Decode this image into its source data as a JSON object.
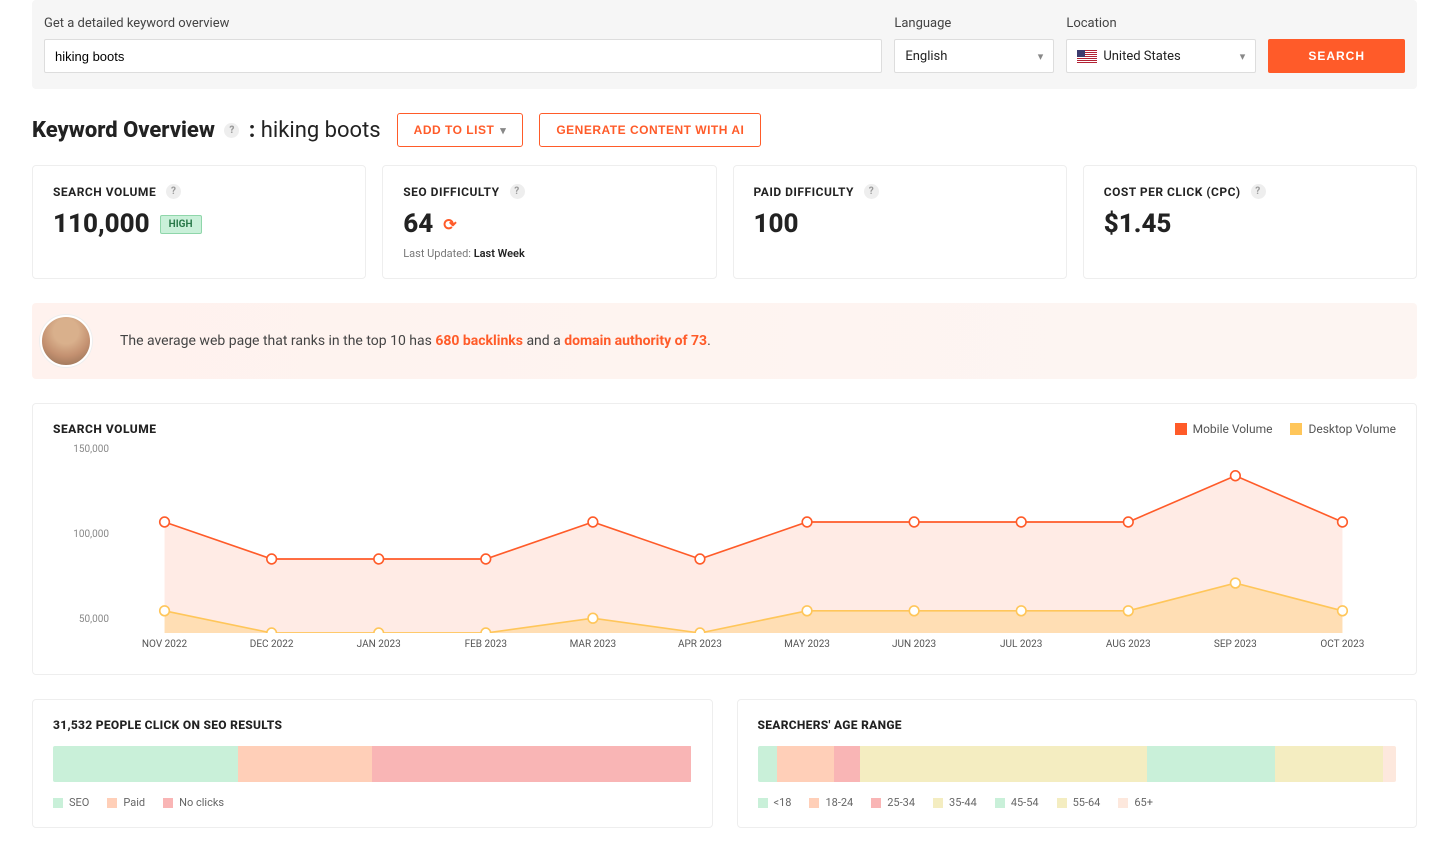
{
  "search": {
    "label": "Get a detailed keyword overview",
    "value": "hiking boots",
    "lang_label": "Language",
    "lang_value": "English",
    "loc_label": "Location",
    "loc_value": "United States",
    "button": "SEARCH"
  },
  "header": {
    "title": "Keyword Overview",
    "keyword": "hiking boots",
    "add_to_list": "ADD TO LIST",
    "generate_ai": "GENERATE CONTENT WITH AI"
  },
  "metrics": {
    "volume": {
      "label": "SEARCH VOLUME",
      "value": "110,000",
      "badge": "HIGH"
    },
    "seo_diff": {
      "label": "SEO DIFFICULTY",
      "value": "64",
      "updated_prefix": "Last Updated:",
      "updated_val": "Last Week"
    },
    "paid_diff": {
      "label": "PAID DIFFICULTY",
      "value": "100"
    },
    "cpc": {
      "label": "COST PER CLICK (CPC)",
      "value": "$1.45"
    }
  },
  "insight": {
    "t1": "The average web page that ranks in the top 10 has ",
    "hl1": "680 backlinks",
    "t2": " and a ",
    "hl2": "domain authority of 73",
    "t3": "."
  },
  "volchart": {
    "title": "SEARCH VOLUME",
    "legend_mobile": "Mobile Volume",
    "legend_desktop": "Desktop Volume",
    "y150": "150,000",
    "y100": "100,000",
    "y50": "50,000"
  },
  "chart_data": {
    "type": "line",
    "categories": [
      "NOV 2022",
      "DEC 2022",
      "JAN 2023",
      "FEB 2023",
      "MAR 2023",
      "APR 2023",
      "MAY 2023",
      "JUN 2023",
      "JUL 2023",
      "AUG 2023",
      "SEP 2023",
      "OCT 2023"
    ],
    "series": [
      {
        "name": "Mobile Volume",
        "color": "#ff5b29",
        "values": [
          110000,
          90000,
          90000,
          90000,
          110000,
          90000,
          110000,
          110000,
          110000,
          110000,
          135000,
          110000
        ]
      },
      {
        "name": "Desktop Volume",
        "color": "#ffc65a",
        "values": [
          62000,
          50000,
          50000,
          50000,
          58000,
          50000,
          62000,
          62000,
          62000,
          62000,
          77000,
          62000
        ]
      }
    ],
    "ylim": [
      50000,
      150000
    ],
    "xlabel": "",
    "ylabel": ""
  },
  "clicks": {
    "title": "31,532 PEOPLE CLICK ON SEO RESULTS",
    "segments": [
      {
        "label": "SEO",
        "color": "#c9f0d9",
        "pct": 29
      },
      {
        "label": "Paid",
        "color": "#ffcfb8",
        "pct": 21
      },
      {
        "label": "No clicks",
        "color": "#f9b5b5",
        "pct": 50
      }
    ]
  },
  "age": {
    "title": "SEARCHERS' AGE RANGE",
    "segments": [
      {
        "label": "<18",
        "color": "#c9f0d9",
        "pct": 3
      },
      {
        "label": "18-24",
        "color": "#ffcfb8",
        "pct": 9
      },
      {
        "label": "25-34",
        "color": "#f9b5b5",
        "pct": 4
      },
      {
        "label": "35-44",
        "color": "#f4edc1",
        "pct": 45
      },
      {
        "label": "45-54",
        "color": "#c9f0d9",
        "pct": 20
      },
      {
        "label": "55-64",
        "color": "#f4edc1",
        "pct": 17
      },
      {
        "label": "65+",
        "color": "#fde8dd",
        "pct": 2
      }
    ]
  }
}
